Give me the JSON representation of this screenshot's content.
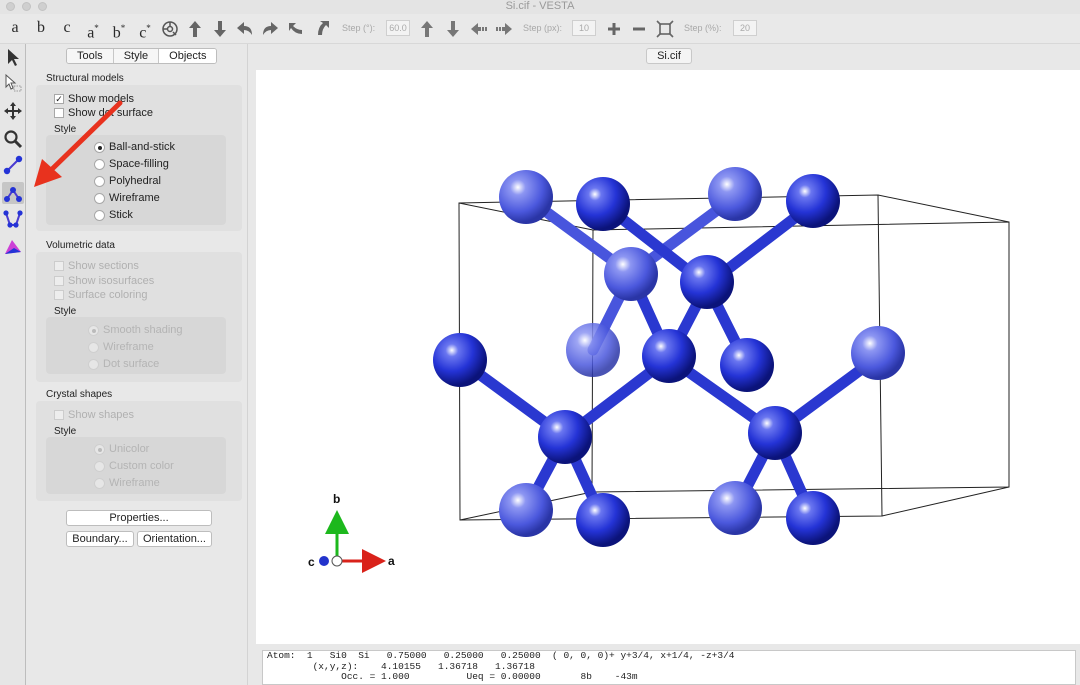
{
  "window": {
    "title": "Si.cif - VESTA"
  },
  "toolbar": {
    "axis_buttons": [
      {
        "base": "a",
        "sup": ""
      },
      {
        "base": "b",
        "sup": ""
      },
      {
        "base": "c",
        "sup": ""
      },
      {
        "base": "a",
        "sup": "*"
      },
      {
        "base": "b",
        "sup": "*"
      },
      {
        "base": "c",
        "sup": "*"
      }
    ],
    "step_deg_label": "Step (°):",
    "step_deg_value": "60.0",
    "step_px_label": "Step (px):",
    "step_px_value": "10",
    "step_pct_label": "Step (%):",
    "step_pct_value": "20"
  },
  "panel": {
    "tabs": [
      "Tools",
      "Style",
      "Objects"
    ],
    "structural": {
      "title": "Structural models",
      "show_models": "Show models",
      "show_dot_surface": "Show dot surface",
      "style_label": "Style",
      "options": [
        "Ball-and-stick",
        "Space-filling",
        "Polyhedral",
        "Wireframe",
        "Stick"
      ]
    },
    "volumetric": {
      "title": "Volumetric data",
      "show_sections": "Show sections",
      "show_isosurfaces": "Show isosurfaces",
      "surface_coloring": "Surface coloring",
      "style_label": "Style",
      "options": [
        "Smooth shading",
        "Wireframe",
        "Dot surface"
      ]
    },
    "crystal": {
      "title": "Crystal shapes",
      "show_shapes": "Show shapes",
      "style_label": "Style",
      "options": [
        "Unicolor",
        "Custom color",
        "Wireframe"
      ]
    },
    "buttons": {
      "properties": "Properties...",
      "boundary": "Boundary...",
      "orientation": "Orientation..."
    }
  },
  "viewer": {
    "tab": "Si.cif",
    "axes": {
      "a": "a",
      "b": "b",
      "c": "c"
    },
    "atom_color": "#2433d6"
  },
  "console": {
    "line1": "Atom:  1   Si0  Si   0.75000   0.25000   0.25000  ( 0, 0, 0)+ y+3/4, x+1/4, -z+3/4",
    "line2": "        (x,y,z):    4.10155   1.36718   1.36718",
    "line3": "             Occ. = 1.000          Ueq = 0.00000       8b    -43m"
  },
  "colors": {
    "accent_arrow": "#e8321e",
    "atom": "#2433d6",
    "axis_a": "#d9221a",
    "axis_b": "#1db81d",
    "axis_c": "#2233cc"
  }
}
